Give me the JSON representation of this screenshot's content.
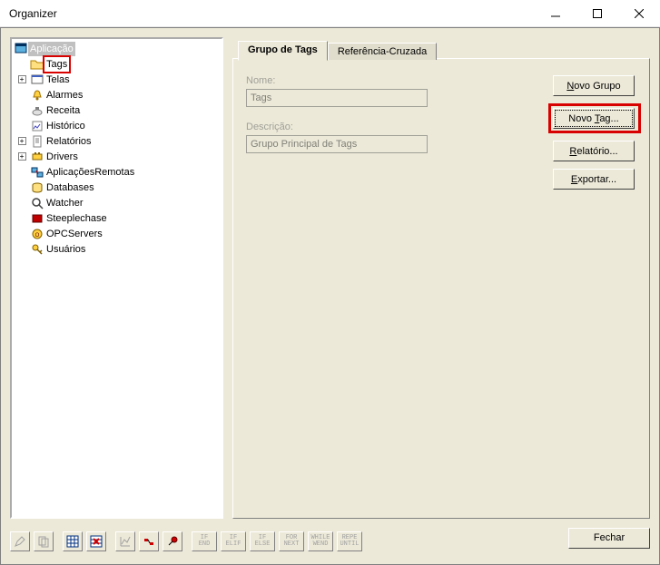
{
  "window": {
    "title": "Organizer"
  },
  "tree": {
    "root": "Aplicação",
    "items": [
      {
        "label": "Tags",
        "highlighted": true,
        "expand": ""
      },
      {
        "label": "Telas",
        "expand": "+"
      },
      {
        "label": "Alarmes",
        "expand": ""
      },
      {
        "label": "Receita",
        "expand": ""
      },
      {
        "label": "Histórico",
        "expand": ""
      },
      {
        "label": "Relatórios",
        "expand": "+"
      },
      {
        "label": "Drivers",
        "expand": "+"
      },
      {
        "label": "AplicaçõesRemotas",
        "expand": ""
      },
      {
        "label": "Databases",
        "expand": ""
      },
      {
        "label": "Watcher",
        "expand": ""
      },
      {
        "label": "Steeplechase",
        "expand": ""
      },
      {
        "label": "OPCServers",
        "expand": ""
      },
      {
        "label": "Usuários",
        "expand": ""
      }
    ]
  },
  "tabs": {
    "active": "Grupo de Tags",
    "inactive": "Referência-Cruzada"
  },
  "form": {
    "name_label": "Nome:",
    "name_value": "Tags",
    "desc_label": "Descrição:",
    "desc_value": "Grupo Principal de Tags"
  },
  "buttons": {
    "novo_grupo": "Novo Grupo",
    "novo_tag": "Novo Tag...",
    "relatorio": "Relatório...",
    "exportar": "Exportar...",
    "fechar": "Fechar"
  },
  "script_buttons": [
    {
      "top": "IF",
      "bot": "END"
    },
    {
      "top": "IF",
      "bot": "ELIF"
    },
    {
      "top": "IF",
      "bot": "ELSE"
    },
    {
      "top": "FOR",
      "bot": "NEXT"
    },
    {
      "top": "WHILE",
      "bot": "WEND"
    },
    {
      "top": "REPE",
      "bot": "UNTIL"
    }
  ]
}
